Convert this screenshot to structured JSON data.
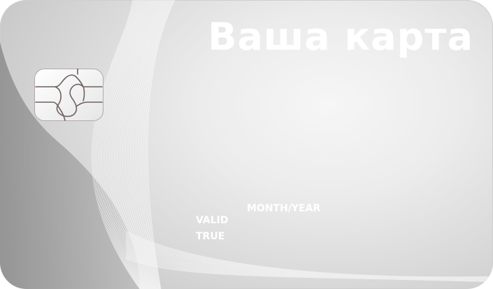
{
  "card": {
    "title": "Ваша карта",
    "valid_label": "VALID",
    "true_label": "TRUE",
    "expiry_placeholder": "MONTH/YEAR"
  },
  "colors": {
    "card_light": "#f4f4f4",
    "card_dark": "#8a8a8a",
    "text": "#ffffff",
    "chip_line": "#7a6a6a"
  },
  "icons": {
    "chip": "emv-chip-icon"
  }
}
